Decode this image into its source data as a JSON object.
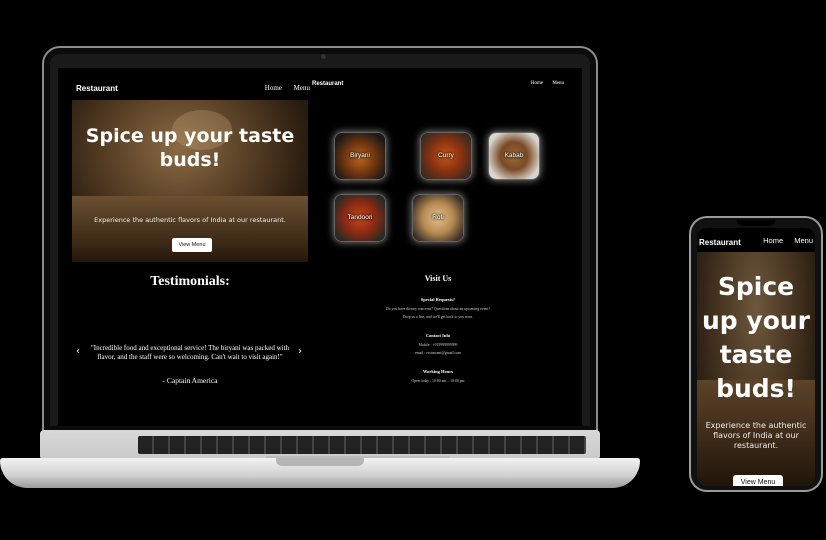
{
  "laptop": {
    "left_page": {
      "brand": "Restaurant",
      "nav": [
        "Home",
        "Menu"
      ],
      "hero": {
        "title": "Spice up your taste buds!",
        "subtitle": "Experience the authentic flavors of India at our restaurant.",
        "button": "View Menu"
      },
      "testimonials": {
        "title": "Testimonials:",
        "quote": "\"Incredible food and exceptional service! The biryani was packed with flavor, and the staff were so welcoming. Can't wait to visit again!\"",
        "author": "- Captain America",
        "prev_arrow": "‹",
        "next_arrow": "›"
      }
    },
    "right_page": {
      "brand": "Restaurant",
      "nav": [
        "Home",
        "Menu"
      ],
      "dishes": [
        "Biryani",
        "Curry",
        "Kabab",
        "Tandoori",
        "Roti"
      ],
      "visit": {
        "title": "Visit Us",
        "special_heading": "Special Requests?",
        "special_line1": "Do you have dietary concerns? Questions about an upcoming event?",
        "special_line2": "Drop us a line, and we'll get back to you soon.",
        "contact_heading": "Contact Info",
        "contact_mobile": "Mobile : +919999999999",
        "contact_email": "email : restaurant@gmail.com",
        "hours_heading": "Working Hours",
        "hours_line": "Open today : 10:00 am – 10:00 pm"
      }
    }
  },
  "phone": {
    "brand": "Restaurant",
    "nav": [
      "Home",
      "Menu"
    ],
    "hero": {
      "title": "Spice up your taste buds!",
      "subtitle": "Experience the authentic flavors of India at our restaurant.",
      "button": "View Menu"
    }
  },
  "colors": {
    "background": "#000000",
    "hero_wood": "#5c4328",
    "text": "#ffffff"
  }
}
